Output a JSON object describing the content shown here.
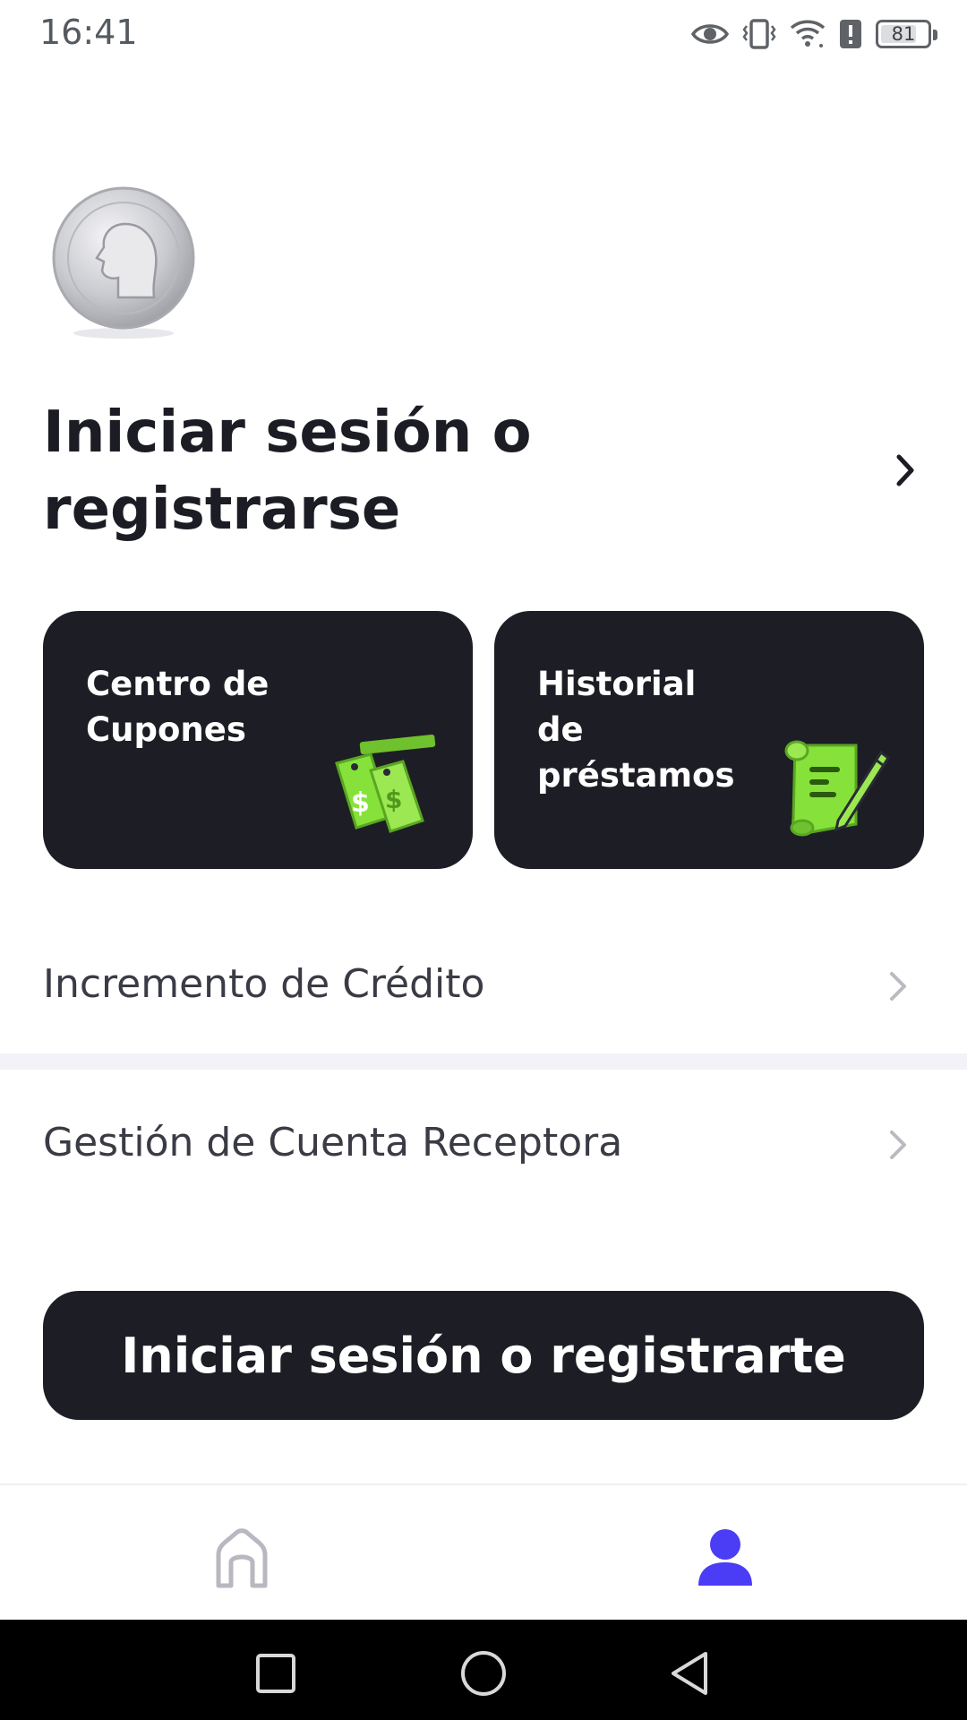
{
  "status_bar": {
    "time": "16:41",
    "battery_level": "81",
    "icons": [
      "eye-icon",
      "vibrate-icon",
      "wifi-icon",
      "alert-icon",
      "battery-icon"
    ]
  },
  "profile": {
    "avatar_icon": "silver-coin-avatar",
    "login_prompt": "Iniciar sesión o registrarse",
    "chevron_icon": "chevron-right-icon"
  },
  "cards": [
    {
      "label": "Centro de Cupones",
      "icon": "coupon-tags-icon"
    },
    {
      "label": "Historial de préstamos",
      "icon": "loan-scroll-icon"
    }
  ],
  "menu": [
    {
      "label": "Incremento de Crédito",
      "icon": "chevron-right-icon"
    },
    {
      "label": "Gestión de Cuenta Receptora",
      "icon": "chevron-right-icon"
    }
  ],
  "primary_button": {
    "label": "Iniciar sesión o registrarte"
  },
  "bottom_nav": {
    "items": [
      {
        "name": "home",
        "icon": "home-icon",
        "active": false
      },
      {
        "name": "profile",
        "icon": "user-icon",
        "active": true
      }
    ],
    "active_color": "#4b3cf5",
    "inactive_color": "#b7b8c0"
  },
  "colors": {
    "dark_surface": "#1d1e25",
    "accent_green": "#86e23a",
    "separator": "#f2f2f8"
  }
}
